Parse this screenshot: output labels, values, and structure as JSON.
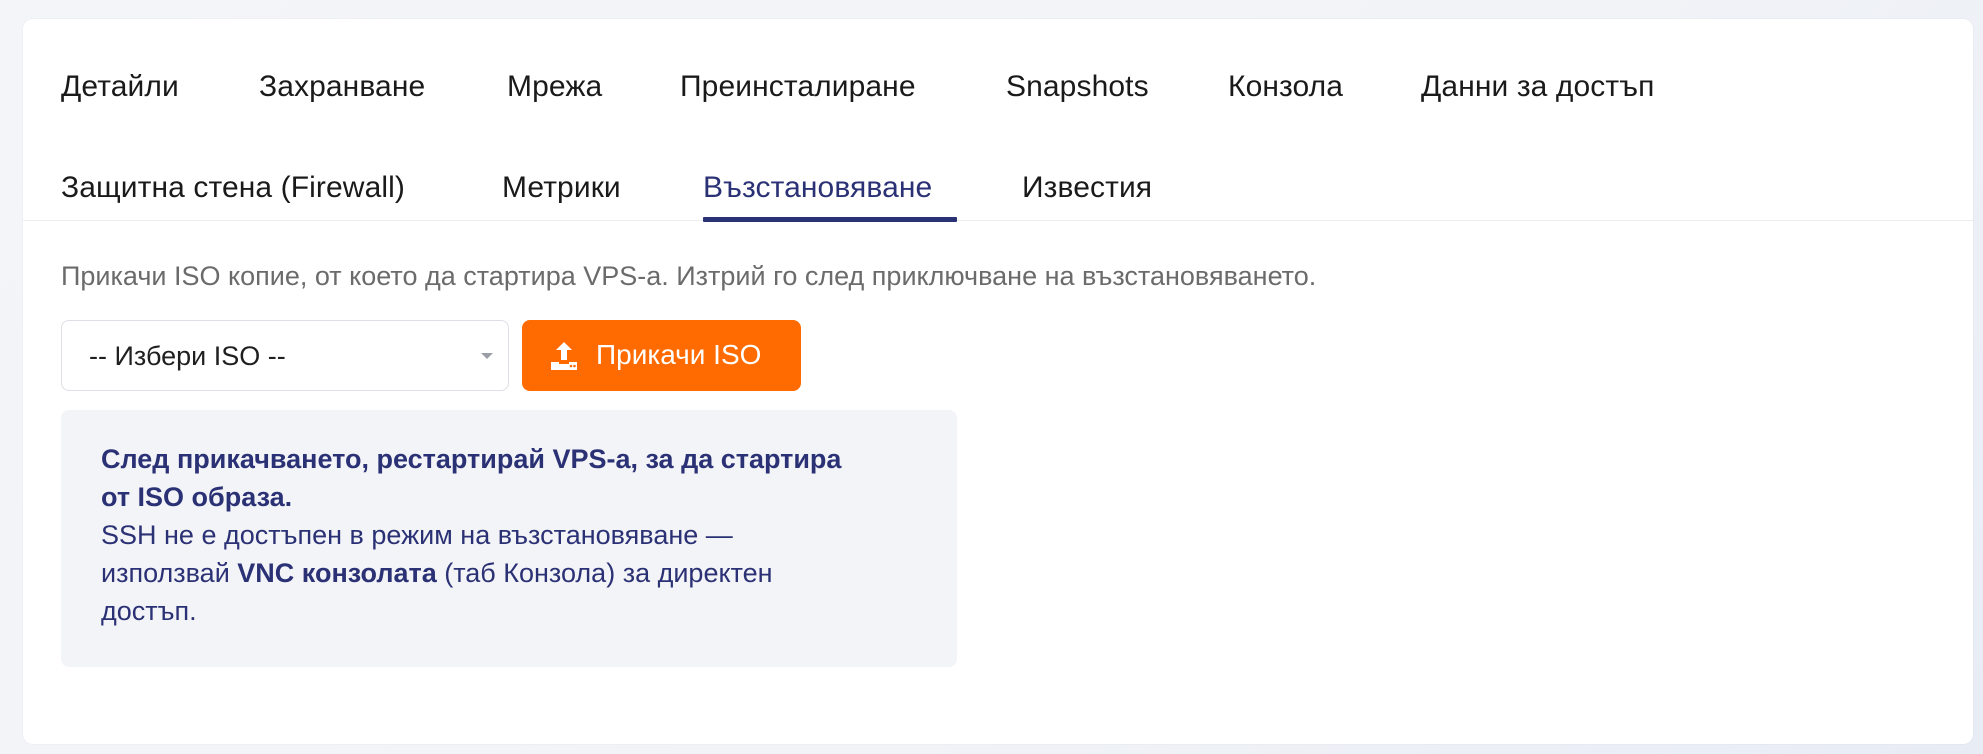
{
  "tabs": [
    {
      "label": "Детайли"
    },
    {
      "label": "Захранване"
    },
    {
      "label": "Мрежа"
    },
    {
      "label": "Преинсталиране"
    },
    {
      "label": "Snapshots"
    },
    {
      "label": "Конзола"
    },
    {
      "label": "Данни за достъп"
    },
    {
      "label": "Защитна стена (Firewall)"
    },
    {
      "label": "Метрики"
    },
    {
      "label": "Възстановяване"
    },
    {
      "label": "Известия"
    }
  ],
  "active_tab": "Възстановяване",
  "description": "Прикачи ISO копие, от което да стартира VPS-а. Изтрий го след приключване на възстановяването.",
  "iso_select": {
    "selected": "-- Избери ISO --"
  },
  "attach_button": {
    "label": "Прикачи ISO",
    "icon": "upload-icon",
    "color": "#ff6b00"
  },
  "info": {
    "bold_line_1": "След прикачването, рестартирай VPS-а, за да стартира",
    "bold_line_2": "от ISO образа.",
    "line_3": "SSH не е достъпен в режим на възстановяване —",
    "line_4_prefix": "използвай ",
    "line_4_bold": "VNC конзолата",
    "line_4_suffix": " (таб Конзола) за директен",
    "line_5": "достъп."
  },
  "colors": {
    "accent": "#2b3175",
    "primary_button": "#ff6b00",
    "info_bg": "#f3f4f7"
  }
}
